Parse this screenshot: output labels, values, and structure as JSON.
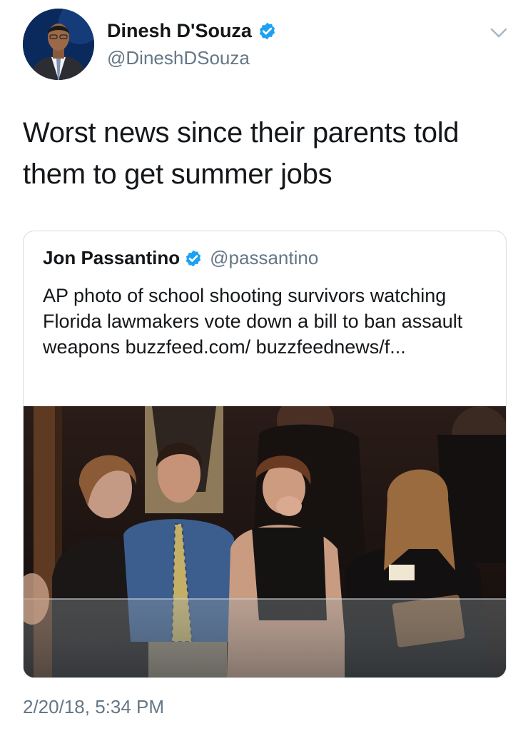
{
  "author": {
    "name": "Dinesh D'Souza",
    "handle": "@DineshDSouza",
    "verified": true,
    "avatar_icon": "profile-photo"
  },
  "tweet": {
    "text": "Worst news since their parents told them to get summer jobs",
    "timestamp": "2/20/18, 5:34 PM"
  },
  "quoted_tweet": {
    "author_name": "Jon Passantino",
    "author_handle": "@passantino",
    "verified": true,
    "text": "AP photo of school shooting survivors watching Florida lawmakers vote down a bill to ban assault weapons buzzfeed.com/ buzzfeednews/f...",
    "media": "photo"
  },
  "icons": {
    "verified": "verified-badge-icon",
    "menu": "chevron-down-icon"
  },
  "colors": {
    "text": "#14171a",
    "secondary": "#657786",
    "verified": "#1da1f2",
    "border": "#d6dde3"
  }
}
